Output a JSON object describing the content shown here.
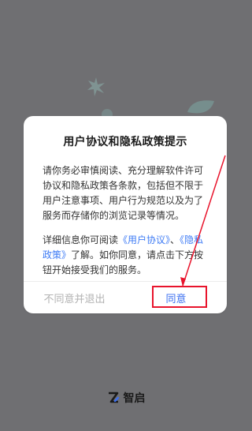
{
  "dialog": {
    "title": "用户协议和隐私政策提示",
    "para1": "请你务必审慎阅读、充分理解软件许可协议和隐私政策各条款，包括但不限于用户注意事项、用户行为规范以及为了服务而存储你的浏览记录等情况。",
    "para2_prefix": "详细信息你可阅读",
    "user_agreement_link": "《用户协议》",
    "para2_sep": "、",
    "privacy_link": "《隐私政策》",
    "para2_suffix": "了解。如你同意，请点击下方按钮开始接受我们的服务。",
    "decline_label": "不同意并退出",
    "agree_label": "同意"
  },
  "brand": {
    "name": "智启",
    "logo_icon": "zhiqi-logo-icon"
  },
  "colors": {
    "overlay_bg": "#6f6f72",
    "link": "#3f7cf5",
    "agree_text": "#3b6ff0",
    "annotation": "#e8142c"
  }
}
